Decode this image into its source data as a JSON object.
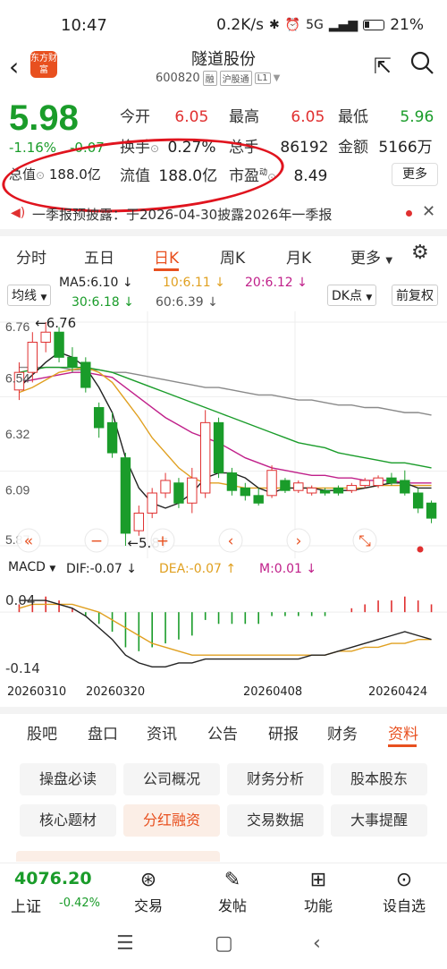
{
  "status": {
    "time": "10:47",
    "speed": "0.2K/s",
    "battery": "21%",
    "net": "5G"
  },
  "header": {
    "title": "隧道股份",
    "code": "600820",
    "tags": [
      "融",
      "沪股通",
      "L1"
    ],
    "logo_text": "东方财富"
  },
  "quote": {
    "price": "5.98",
    "change_pct": "-1.16%",
    "change": "-0.07",
    "open_label": "今开",
    "open": "6.05",
    "high_label": "最高",
    "high": "6.05",
    "low_label": "最低",
    "low": "5.96",
    "turnover_label": "换手",
    "turnover": "0.27%",
    "volume_label": "总手",
    "volume": "86192",
    "amount_label": "金额",
    "amount": "5166万",
    "mcap_label": "总值",
    "mcap": "188.0亿",
    "float_label": "流值",
    "float": "188.0亿",
    "pe_label": "市盈",
    "pe_sup": "动",
    "pe": "8.49",
    "more_label": "更多"
  },
  "announce": {
    "text": "一季报预披露：于2026-04-30披露2026年一季报"
  },
  "chart_tabs": {
    "items": [
      "分时",
      "五日",
      "日K",
      "周K",
      "月K",
      "更多"
    ],
    "active": "日K"
  },
  "ma_legend": {
    "type_label": "均线",
    "ma5": "MA5:6.10 ↓",
    "ma10": "10:6.11 ↓",
    "ma20": "20:6.12 ↓",
    "ma30": "30:6.18 ↓",
    "ma60": "60:6.39 ↓",
    "dk_label": "DK点",
    "adj_label": "前复权"
  },
  "chart_data": {
    "type": "candlestick",
    "y_ticks": [
      "6.76",
      "6.54",
      "6.32",
      "6.09",
      "5.87"
    ],
    "ylim": [
      5.87,
      6.76
    ],
    "high_marker": "←6.76",
    "low_marker": "←5.87",
    "x_labels": [
      "20260310",
      "20260320",
      "20260408",
      "20260424"
    ],
    "candles": [
      {
        "o": 6.49,
        "c": 6.56,
        "h": 6.6,
        "l": 6.45
      },
      {
        "o": 6.56,
        "c": 6.68,
        "h": 6.72,
        "l": 6.52
      },
      {
        "o": 6.68,
        "c": 6.72,
        "h": 6.76,
        "l": 6.64
      },
      {
        "o": 6.72,
        "c": 6.62,
        "h": 6.74,
        "l": 6.6
      },
      {
        "o": 6.62,
        "c": 6.58,
        "h": 6.66,
        "l": 6.56
      },
      {
        "o": 6.6,
        "c": 6.5,
        "h": 6.62,
        "l": 6.48
      },
      {
        "o": 6.42,
        "c": 6.34,
        "h": 6.44,
        "l": 6.3
      },
      {
        "o": 6.36,
        "c": 6.24,
        "h": 6.4,
        "l": 6.22
      },
      {
        "o": 6.22,
        "c": 5.92,
        "h": 6.24,
        "l": 5.87
      },
      {
        "o": 5.93,
        "c": 6.0,
        "h": 6.03,
        "l": 5.91
      },
      {
        "o": 6.0,
        "c": 6.08,
        "h": 6.1,
        "l": 5.98
      },
      {
        "o": 6.08,
        "c": 6.13,
        "h": 6.16,
        "l": 6.06
      },
      {
        "o": 6.12,
        "c": 6.04,
        "h": 6.14,
        "l": 6.02
      },
      {
        "o": 6.04,
        "c": 6.14,
        "h": 6.18,
        "l": 6.0
      },
      {
        "o": 6.08,
        "c": 6.36,
        "h": 6.41,
        "l": 6.06
      },
      {
        "o": 6.36,
        "c": 6.16,
        "h": 6.38,
        "l": 6.14
      },
      {
        "o": 6.16,
        "c": 6.09,
        "h": 6.18,
        "l": 6.07
      },
      {
        "o": 6.1,
        "c": 6.07,
        "h": 6.12,
        "l": 6.05
      },
      {
        "o": 6.07,
        "c": 6.04,
        "h": 6.1,
        "l": 6.03
      },
      {
        "o": 6.07,
        "c": 6.17,
        "h": 6.19,
        "l": 6.06
      },
      {
        "o": 6.13,
        "c": 6.09,
        "h": 6.14,
        "l": 6.08
      },
      {
        "o": 6.09,
        "c": 6.12,
        "h": 6.13,
        "l": 6.08
      },
      {
        "o": 6.08,
        "c": 6.1,
        "h": 6.11,
        "l": 6.07
      },
      {
        "o": 6.09,
        "c": 6.08,
        "h": 6.1,
        "l": 6.07
      },
      {
        "o": 6.1,
        "c": 6.08,
        "h": 6.11,
        "l": 6.07
      },
      {
        "o": 6.09,
        "c": 6.11,
        "h": 6.12,
        "l": 6.08
      },
      {
        "o": 6.11,
        "c": 6.13,
        "h": 6.14,
        "l": 6.1
      },
      {
        "o": 6.11,
        "c": 6.14,
        "h": 6.15,
        "l": 6.1
      },
      {
        "o": 6.14,
        "c": 6.12,
        "h": 6.16,
        "l": 6.11
      },
      {
        "o": 6.13,
        "c": 6.08,
        "h": 6.17,
        "l": 6.07
      },
      {
        "o": 6.08,
        "c": 6.02,
        "h": 6.1,
        "l": 6.0
      },
      {
        "o": 6.04,
        "c": 5.98,
        "h": 6.05,
        "l": 5.96
      }
    ],
    "ma5": [
      6.5,
      6.55,
      6.6,
      6.64,
      6.62,
      6.58,
      6.5,
      6.4,
      6.22,
      6.1,
      6.04,
      6.02,
      6.04,
      6.08,
      6.14,
      6.16,
      6.16,
      6.14,
      6.1,
      6.08,
      6.1,
      6.1,
      6.1,
      6.09,
      6.09,
      6.09,
      6.1,
      6.11,
      6.12,
      6.12,
      6.1,
      6.1
    ],
    "ma10": [
      6.48,
      6.5,
      6.53,
      6.56,
      6.57,
      6.58,
      6.56,
      6.52,
      6.45,
      6.38,
      6.3,
      6.24,
      6.18,
      6.14,
      6.12,
      6.12,
      6.11,
      6.1,
      6.1,
      6.1,
      6.1,
      6.1,
      6.1,
      6.1,
      6.1,
      6.1,
      6.1,
      6.11,
      6.11,
      6.11,
      6.11,
      6.11
    ],
    "ma20": [
      6.52,
      6.53,
      6.54,
      6.55,
      6.56,
      6.56,
      6.55,
      6.54,
      6.5,
      6.46,
      6.42,
      6.38,
      6.35,
      6.32,
      6.3,
      6.28,
      6.25,
      6.22,
      6.2,
      6.18,
      6.17,
      6.16,
      6.15,
      6.15,
      6.14,
      6.14,
      6.13,
      6.13,
      6.13,
      6.12,
      6.12,
      6.12
    ],
    "ma30": [
      6.56,
      6.57,
      6.58,
      6.58,
      6.58,
      6.58,
      6.57,
      6.56,
      6.54,
      6.52,
      6.5,
      6.48,
      6.46,
      6.44,
      6.42,
      6.4,
      6.38,
      6.36,
      6.34,
      6.32,
      6.3,
      6.28,
      6.27,
      6.26,
      6.24,
      6.23,
      6.22,
      6.21,
      6.2,
      6.2,
      6.19,
      6.18
    ],
    "ma60": [
      6.58,
      6.58,
      6.58,
      6.58,
      6.57,
      6.57,
      6.57,
      6.56,
      6.56,
      6.55,
      6.54,
      6.53,
      6.52,
      6.51,
      6.5,
      6.5,
      6.49,
      6.48,
      6.47,
      6.47,
      6.46,
      6.45,
      6.45,
      6.44,
      6.43,
      6.43,
      6.42,
      6.42,
      6.41,
      6.4,
      6.4,
      6.39
    ]
  },
  "macd": {
    "label": "MACD",
    "dif": "DIF:-0.07 ↓",
    "dea": "DEA:-0.07 ↑",
    "m": "M:0.01 ↓",
    "y_ticks": [
      "0.04",
      "-0.14"
    ],
    "bars": [
      0.02,
      0.03,
      0.04,
      0.03,
      0.01,
      -0.01,
      -0.03,
      -0.05,
      -0.09,
      -0.1,
      -0.09,
      -0.08,
      -0.07,
      -0.06,
      -0.02,
      -0.03,
      -0.03,
      -0.03,
      -0.03,
      -0.01,
      -0.01,
      -0.01,
      -0.01,
      -0.01,
      0.0,
      0.01,
      0.02,
      0.03,
      0.03,
      0.04,
      0.03,
      0.02
    ],
    "dif_line": [
      0.03,
      0.03,
      0.03,
      0.02,
      0.01,
      -0.01,
      -0.04,
      -0.07,
      -0.11,
      -0.13,
      -0.14,
      -0.14,
      -0.13,
      -0.13,
      -0.12,
      -0.12,
      -0.12,
      -0.12,
      -0.12,
      -0.12,
      -0.12,
      -0.12,
      -0.11,
      -0.11,
      -0.1,
      -0.09,
      -0.08,
      -0.07,
      -0.06,
      -0.05,
      -0.06,
      -0.07
    ],
    "dea_line": [
      0.01,
      0.02,
      0.02,
      0.02,
      0.02,
      0.01,
      0.0,
      -0.02,
      -0.04,
      -0.06,
      -0.08,
      -0.09,
      -0.1,
      -0.11,
      -0.11,
      -0.11,
      -0.11,
      -0.11,
      -0.11,
      -0.11,
      -0.11,
      -0.11,
      -0.11,
      -0.11,
      -0.1,
      -0.1,
      -0.09,
      -0.09,
      -0.08,
      -0.08,
      -0.07,
      -0.07
    ]
  },
  "content_tabs": {
    "items": [
      "股吧",
      "盘口",
      "资讯",
      "公告",
      "研报",
      "财务",
      "资料"
    ],
    "active": "资料"
  },
  "chips": [
    "操盘必读",
    "公司概况",
    "财务分析",
    "股本股东",
    "核心题材",
    "分红融资",
    "交易数据",
    "大事提醒"
  ],
  "chip_active": "分红融资",
  "toolbar": {
    "index_value": "4076.20",
    "index_name": "上证",
    "index_change": "-0.42%",
    "items": [
      {
        "label": "交易",
        "icon": "trade-icon"
      },
      {
        "label": "发帖",
        "icon": "post-icon"
      },
      {
        "label": "功能",
        "icon": "apps-icon"
      },
      {
        "label": "设自选",
        "icon": "more-icon"
      }
    ]
  },
  "colors": {
    "up": "#e03030",
    "down": "#1a9c2a",
    "accent": "#e8501f"
  }
}
